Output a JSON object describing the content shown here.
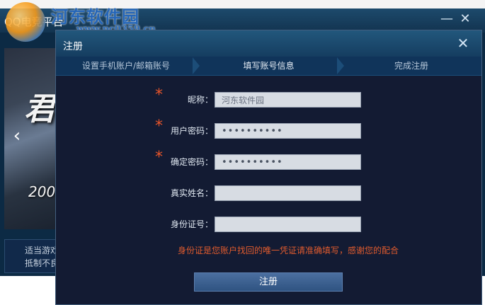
{
  "outer_window": {
    "title": "QQ电竞平台",
    "minimize_glyph": "—",
    "close_glyph": "✕"
  },
  "watermark": {
    "text": "河东软件园",
    "url": "www.pc0359.cn"
  },
  "banner": {
    "glyph": "君",
    "year": "200",
    "prev_glyph": "‹"
  },
  "notice": {
    "line1": "适当游戏",
    "line2": "抵制不良"
  },
  "modal": {
    "title": "注册",
    "close_glyph": "✕",
    "steps": [
      {
        "label": "设置手机账户/邮箱账号"
      },
      {
        "label": "填写账号信息"
      },
      {
        "label": "完成注册"
      }
    ],
    "required_mark": "*",
    "fields": {
      "nickname": {
        "label": "昵称：",
        "value": "河东软件园"
      },
      "password": {
        "label": "用户密码：",
        "value": "••••••••••"
      },
      "confirm_password": {
        "label": "确定密码：",
        "value": "••••••••••"
      },
      "real_name": {
        "label": "真实姓名：",
        "value": ""
      },
      "id_number": {
        "label": "身份证号：",
        "value": ""
      }
    },
    "hint": "身份证是您账户找回的唯一凭证请准确填写，感谢您的配合",
    "submit_label": "注册"
  },
  "colors": {
    "required": "#e8552a",
    "hint": "#e05b2e",
    "modal_bg": "#131b33",
    "titlebar": "#1d4a6c"
  },
  "icons": {
    "outer_minimize": "minimize-icon",
    "outer_close": "close-icon",
    "modal_close": "close-icon",
    "banner_prev": "chevron-left-icon",
    "watermark_logo": "logo-icon"
  }
}
